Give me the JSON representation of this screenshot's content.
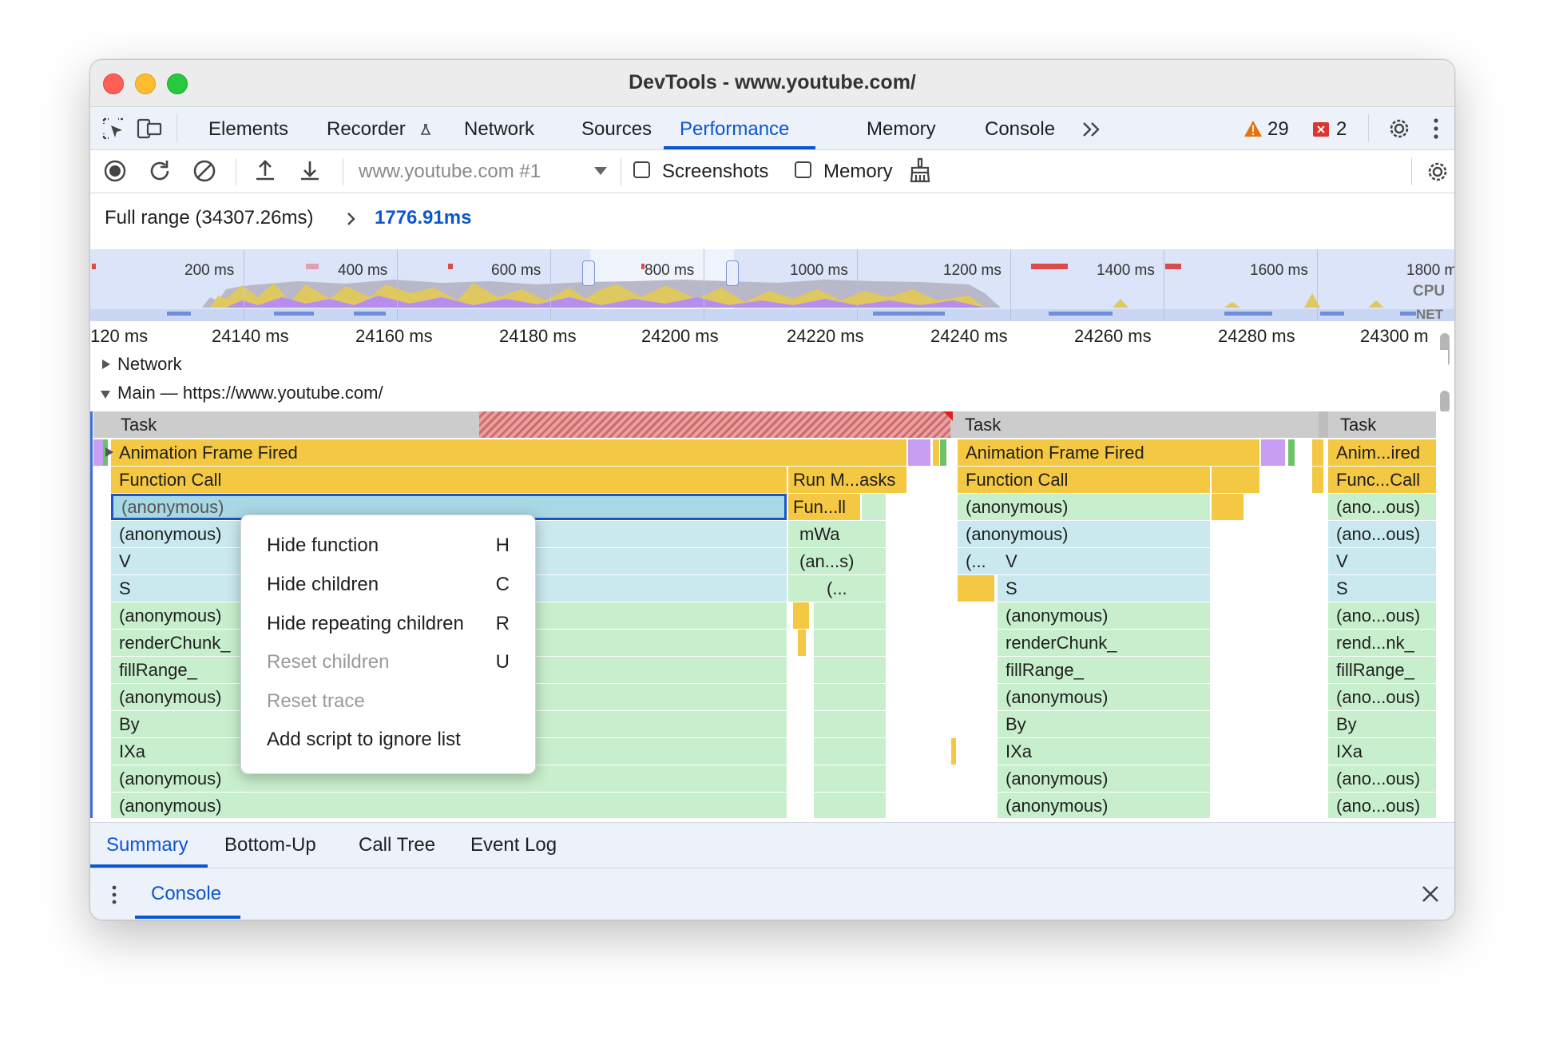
{
  "window": {
    "title": "DevTools - www.youtube.com/"
  },
  "tabs": {
    "items": [
      {
        "label": "Elements"
      },
      {
        "label": "Recorder"
      },
      {
        "label": "Network"
      },
      {
        "label": "Sources"
      },
      {
        "label": "Performance"
      },
      {
        "label": "Memory"
      },
      {
        "label": "Console"
      }
    ],
    "active": "Performance",
    "more_icon": "chevron-double-right-icon",
    "warnings_count": "29",
    "errors_count": "2"
  },
  "toolbar": {
    "target": "www.youtube.com #1",
    "screenshots_label": "Screenshots",
    "memory_label": "Memory",
    "screenshots_checked": false,
    "memory_checked": false
  },
  "range": {
    "full_range": "Full range (34307.26ms)",
    "selected": "1776.91ms"
  },
  "overview": {
    "ticks": [
      "200 ms",
      "400 ms",
      "600 ms",
      "800 ms",
      "1000 ms",
      "1200 ms",
      "1400 ms",
      "1600 ms",
      "1800 m"
    ],
    "cpu_label": "CPU",
    "net_label": "NET"
  },
  "ruler": {
    "ticks": [
      "120 ms",
      "24140 ms",
      "24160 ms",
      "24180 ms",
      "24200 ms",
      "24220 ms",
      "24240 ms",
      "24260 ms",
      "24280 ms",
      "24300 m"
    ]
  },
  "tracks": {
    "network": "Network",
    "main": "Main — https://www.youtube.com/"
  },
  "flame": {
    "task": "Task",
    "animation_frame_fired": "Animation Frame Fired",
    "anim_short": "Anim...ired",
    "function_call": "Function Call",
    "func_short": "Func...Call",
    "run_microtasks": "Run M...asks",
    "fun_short": "Fun...ll",
    "mwa": "mWa",
    "ans": "(an...s)",
    "paren": "(...",
    "anonymous": "(anonymous)",
    "ano_short": "(ano...ous)",
    "v": "V",
    "s": "S",
    "render_chunk": "renderChunk_",
    "rend_short": "rend...nk_",
    "fill_range": "fillRange_",
    "by": "By",
    "ixa": "IXa"
  },
  "context_menu": {
    "items": [
      {
        "label": "Hide function",
        "key": "H",
        "enabled": true
      },
      {
        "label": "Hide children",
        "key": "C",
        "enabled": true
      },
      {
        "label": "Hide repeating children",
        "key": "R",
        "enabled": true
      },
      {
        "label": "Reset children",
        "key": "U",
        "enabled": false
      },
      {
        "label": "Reset trace",
        "key": "",
        "enabled": false
      },
      {
        "label": "Add script to ignore list",
        "key": "",
        "enabled": true
      }
    ]
  },
  "bottom_tabs": {
    "items": [
      {
        "label": "Summary"
      },
      {
        "label": "Bottom-Up"
      },
      {
        "label": "Call Tree"
      },
      {
        "label": "Event Log"
      }
    ],
    "active": "Summary"
  },
  "drawer": {
    "console_label": "Console"
  },
  "colors": {
    "accent": "#0b57d0",
    "task_gray": "#cccccc",
    "animation_yellow": "#f4c842",
    "js_light_blue": "#c9e9ef",
    "js_light_green": "#c8efcd",
    "selected_blue": "#a8d8e4",
    "purple": "#c79ef2"
  }
}
